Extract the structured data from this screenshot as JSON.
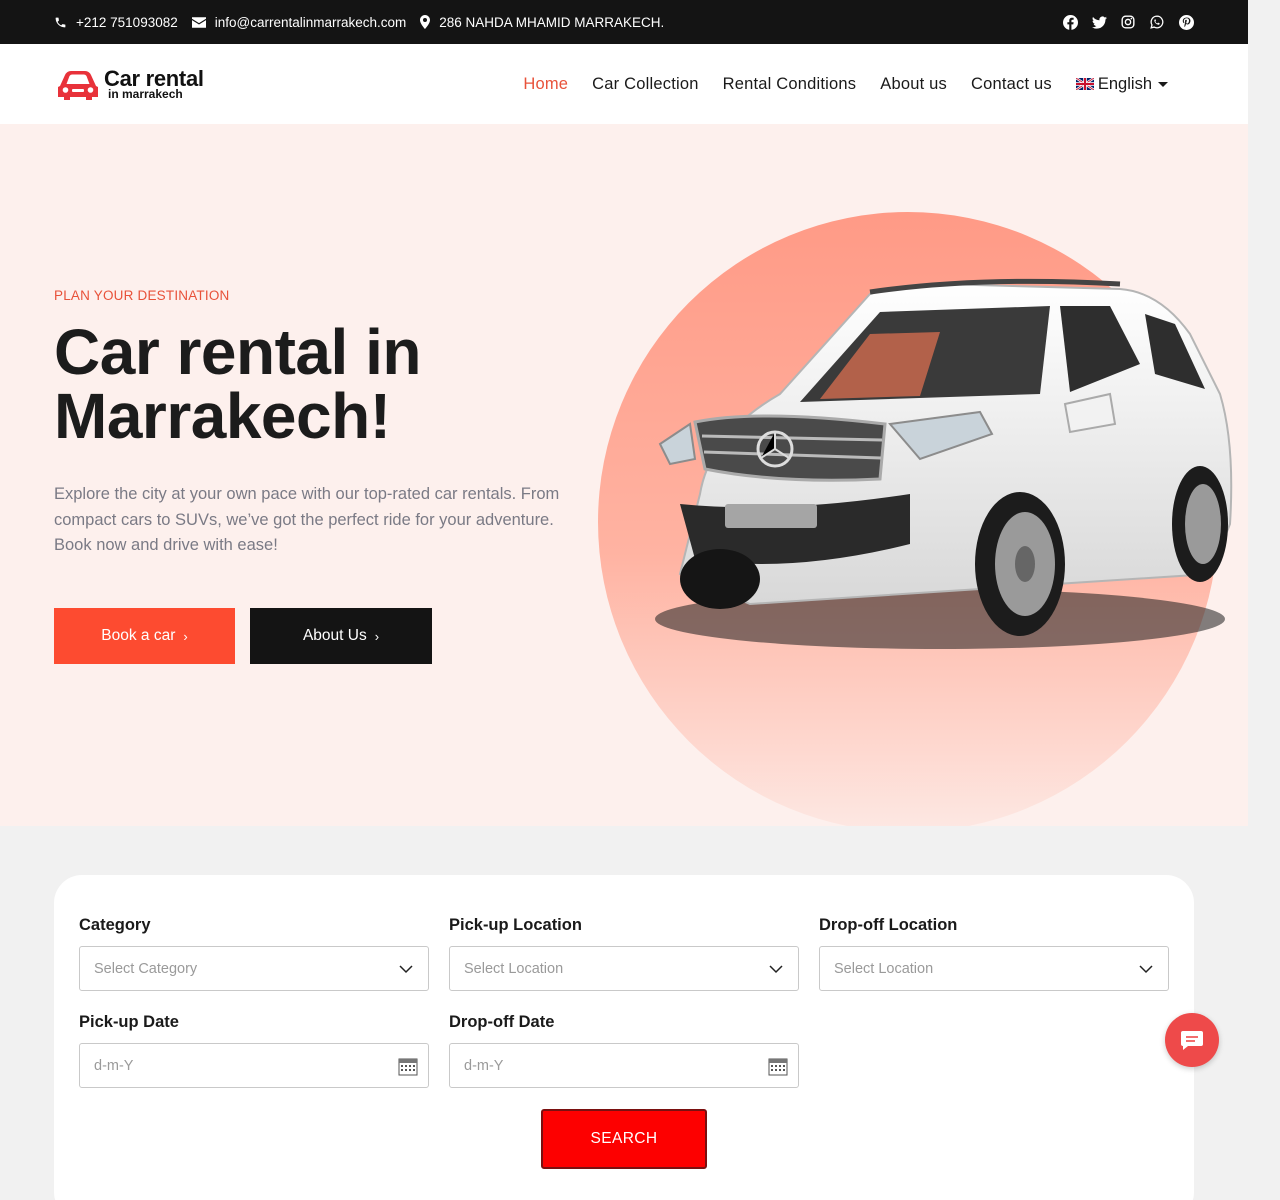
{
  "topbar": {
    "phone": "+212 751093082",
    "email": "info@carrentalinmarrakech.com",
    "address": "286 NAHDA MHAMID MARRAKECH.",
    "social_icons": [
      "facebook-icon",
      "twitter-icon",
      "instagram-icon",
      "whatsapp-icon",
      "pinterest-icon"
    ]
  },
  "header": {
    "logo_main": "Car rental",
    "logo_sub": "in marrakech",
    "nav": [
      "Home",
      "Car Collection",
      "Rental Conditions",
      "About us",
      "Contact us"
    ],
    "active_nav": "Home",
    "language": "English"
  },
  "hero": {
    "eyebrow": "PLAN YOUR DESTINATION",
    "title_line1": "Car rental in",
    "title_line2": "Marrakech!",
    "description": "Explore the city at your own pace with our top-rated car rentals. From compact cars to SUVs, we’ve got the perfect ride for your adventure. Book now and drive with ease!",
    "btn_book": "Book a car",
    "btn_about": "About Us"
  },
  "search": {
    "category_label": "Category",
    "category_placeholder": "Select Category",
    "pickup_location_label": "Pick-up Location",
    "pickup_location_placeholder": "Select Location",
    "dropoff_location_label": "Drop-off Location",
    "dropoff_location_placeholder": "Select Location",
    "pickup_date_label": "Pick-up Date",
    "pickup_date_placeholder": "d-m-Y",
    "dropoff_date_label": "Drop-off Date",
    "dropoff_date_placeholder": "d-m-Y",
    "button": "SEARCH"
  },
  "colors": {
    "accent": "#fd4b30",
    "nav_active": "#e8523a",
    "topbar_bg": "#141414",
    "hero_bg": "#fdf0ed",
    "search_button": "#fd0000"
  }
}
